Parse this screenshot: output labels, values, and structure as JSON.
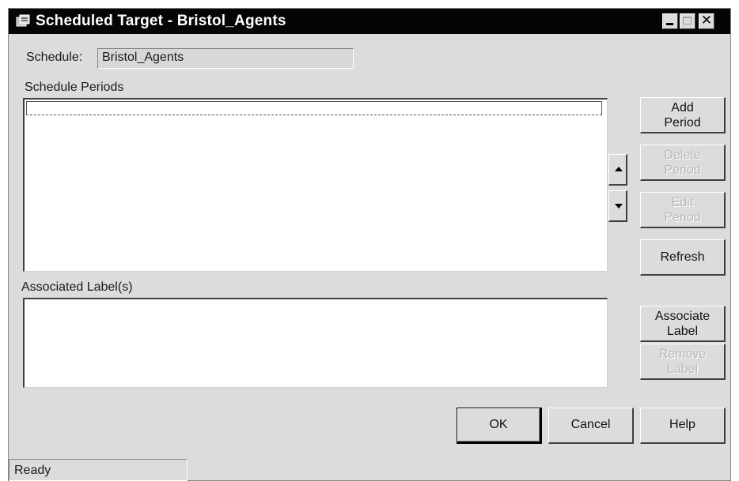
{
  "window": {
    "title": "Scheduled Target - Bristol_Agents",
    "icon": "scheduled-target-icon",
    "controls": {
      "minimize": "minimize-icon",
      "maximize": "maximize-icon",
      "close_glyph": "✕"
    }
  },
  "schedule": {
    "label": "Schedule:",
    "value": "Bristol_Agents"
  },
  "schedule_periods": {
    "label": "Schedule Periods",
    "items": []
  },
  "associated_labels": {
    "label": "Associated Label(s)",
    "items": []
  },
  "side_buttons": {
    "add_period": [
      "Add",
      "Period"
    ],
    "delete_period": [
      "Delete",
      "Period"
    ],
    "edit_period": [
      "Edit",
      "Period"
    ],
    "refresh": "Refresh",
    "associate_label": [
      "Associate",
      "Label"
    ],
    "remove_label": [
      "Remove",
      "Label"
    ]
  },
  "bottom_buttons": {
    "ok": "OK",
    "cancel": "Cancel",
    "help": "Help"
  },
  "status": {
    "text": "Ready"
  }
}
